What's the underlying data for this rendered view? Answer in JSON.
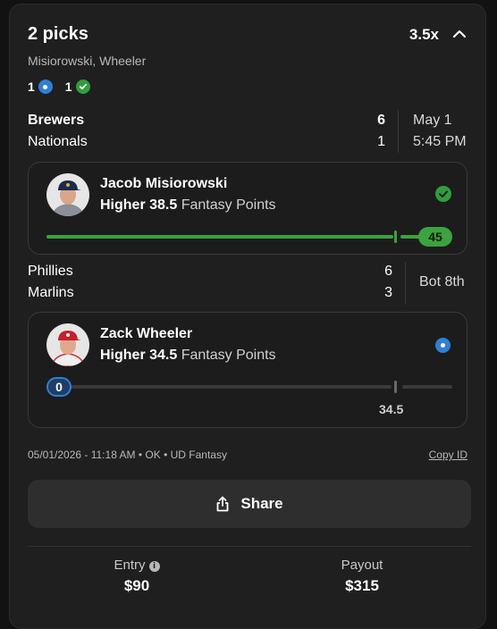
{
  "header": {
    "title": "2 picks",
    "multiplier": "3.5x",
    "player_names": "Misiorowski, Wheeler",
    "live_count": "1",
    "won_count": "1"
  },
  "games": [
    {
      "team1": "Brewers",
      "score1": "6",
      "team2": "Nationals",
      "score2": "1",
      "date": "May 1",
      "time": "5:45 PM"
    },
    {
      "team1": "Phillies",
      "score1": "6",
      "team2": "Marlins",
      "score2": "3",
      "status": "Bot 8th"
    }
  ],
  "picks": [
    {
      "player": "Jacob Misiorowski",
      "direction": "Higher",
      "line": "38.5",
      "stat": "Fantasy Points",
      "current": "45",
      "progress": 1.0,
      "result": "won",
      "color": "#3aa33f"
    },
    {
      "player": "Zack Wheeler",
      "direction": "Higher",
      "line": "34.5",
      "stat": "Fantasy Points",
      "current": "0",
      "progress": 0.0,
      "result": "live",
      "color": "#2f7fd7"
    }
  ],
  "meta": {
    "info": "05/01/2026 - 11:18 AM • OK • UD Fantasy",
    "copy_id": "Copy ID"
  },
  "share_label": "Share",
  "footer": {
    "entry_label": "Entry",
    "entry_value": "$90",
    "payout_label": "Payout",
    "payout_value": "$315"
  }
}
